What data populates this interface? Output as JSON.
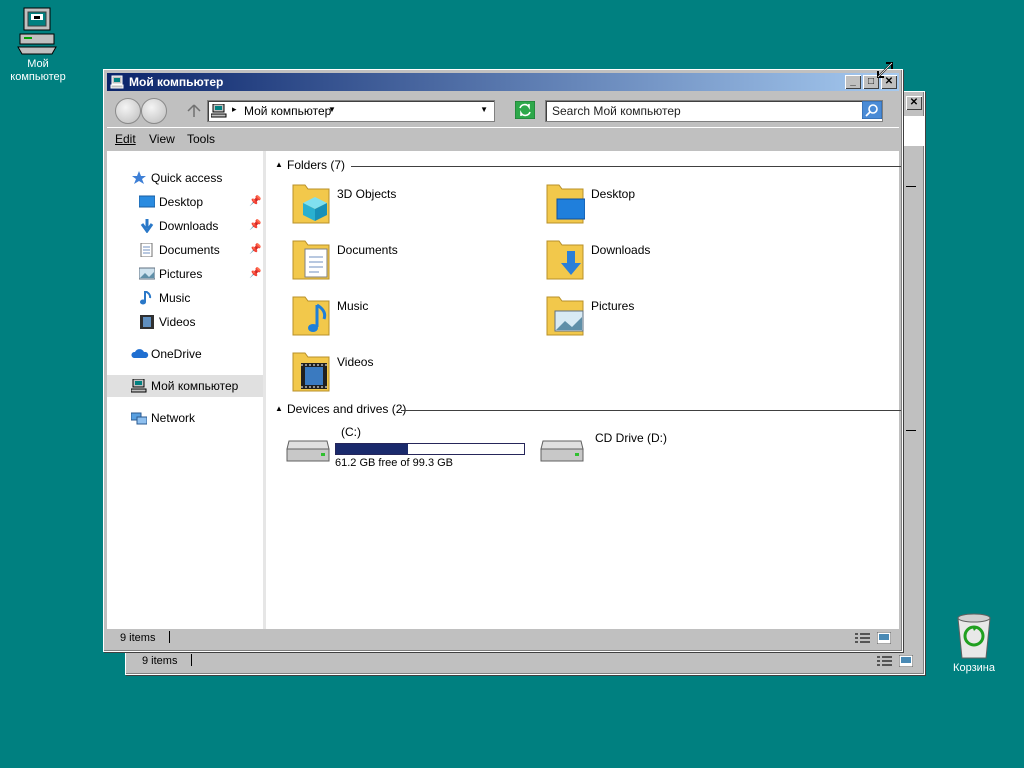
{
  "desktop": {
    "my_computer_label": "Мой компьютер",
    "recycle_bin_label": "Корзина"
  },
  "back_window": {
    "status_count": "9 items"
  },
  "window": {
    "title": "Мой компьютер",
    "address": "Мой компьютер",
    "search_placeholder": "Search Мой компьютер",
    "menu": [
      "Edit",
      "View",
      "Tools"
    ],
    "sidebar": [
      {
        "label": "Quick access",
        "icon": "star-icon"
      },
      {
        "label": "Desktop",
        "icon": "desktop-icon",
        "pinned": true
      },
      {
        "label": "Downloads",
        "icon": "download-icon",
        "pinned": true
      },
      {
        "label": "Documents",
        "icon": "document-icon",
        "pinned": true
      },
      {
        "label": "Pictures",
        "icon": "picture-icon",
        "pinned": true
      },
      {
        "label": "Music",
        "icon": "music-icon"
      },
      {
        "label": "Videos",
        "icon": "video-icon"
      },
      {
        "label": "OneDrive",
        "icon": "cloud-icon"
      },
      {
        "label": "Мой компьютер",
        "icon": "computer-icon",
        "selected": true
      },
      {
        "label": "Network",
        "icon": "network-icon"
      }
    ],
    "folders_header": "Folders (7)",
    "folders": [
      {
        "label": "3D Objects",
        "icon": "3d-objects-folder-icon"
      },
      {
        "label": "Desktop",
        "icon": "desktop-folder-icon"
      },
      {
        "label": "Documents",
        "icon": "documents-folder-icon"
      },
      {
        "label": "Downloads",
        "icon": "downloads-folder-icon"
      },
      {
        "label": "Music",
        "icon": "music-folder-icon"
      },
      {
        "label": "Pictures",
        "icon": "pictures-folder-icon"
      },
      {
        "label": "Videos",
        "icon": "videos-folder-icon"
      }
    ],
    "devices_header": "Devices and drives (2)",
    "drives": [
      {
        "label": "(C:)",
        "free_text": "61.2 GB free of 99.3 GB",
        "used_fraction": 0.384
      },
      {
        "label": "CD Drive (D:)"
      }
    ],
    "status_count": "9 items"
  },
  "colors": {
    "desktop": "#008080",
    "titlebar_start": "#0a246a",
    "titlebar_end": "#a6caf0",
    "drive_bar": "#1a2a6c",
    "folder": "#f2c84b"
  }
}
